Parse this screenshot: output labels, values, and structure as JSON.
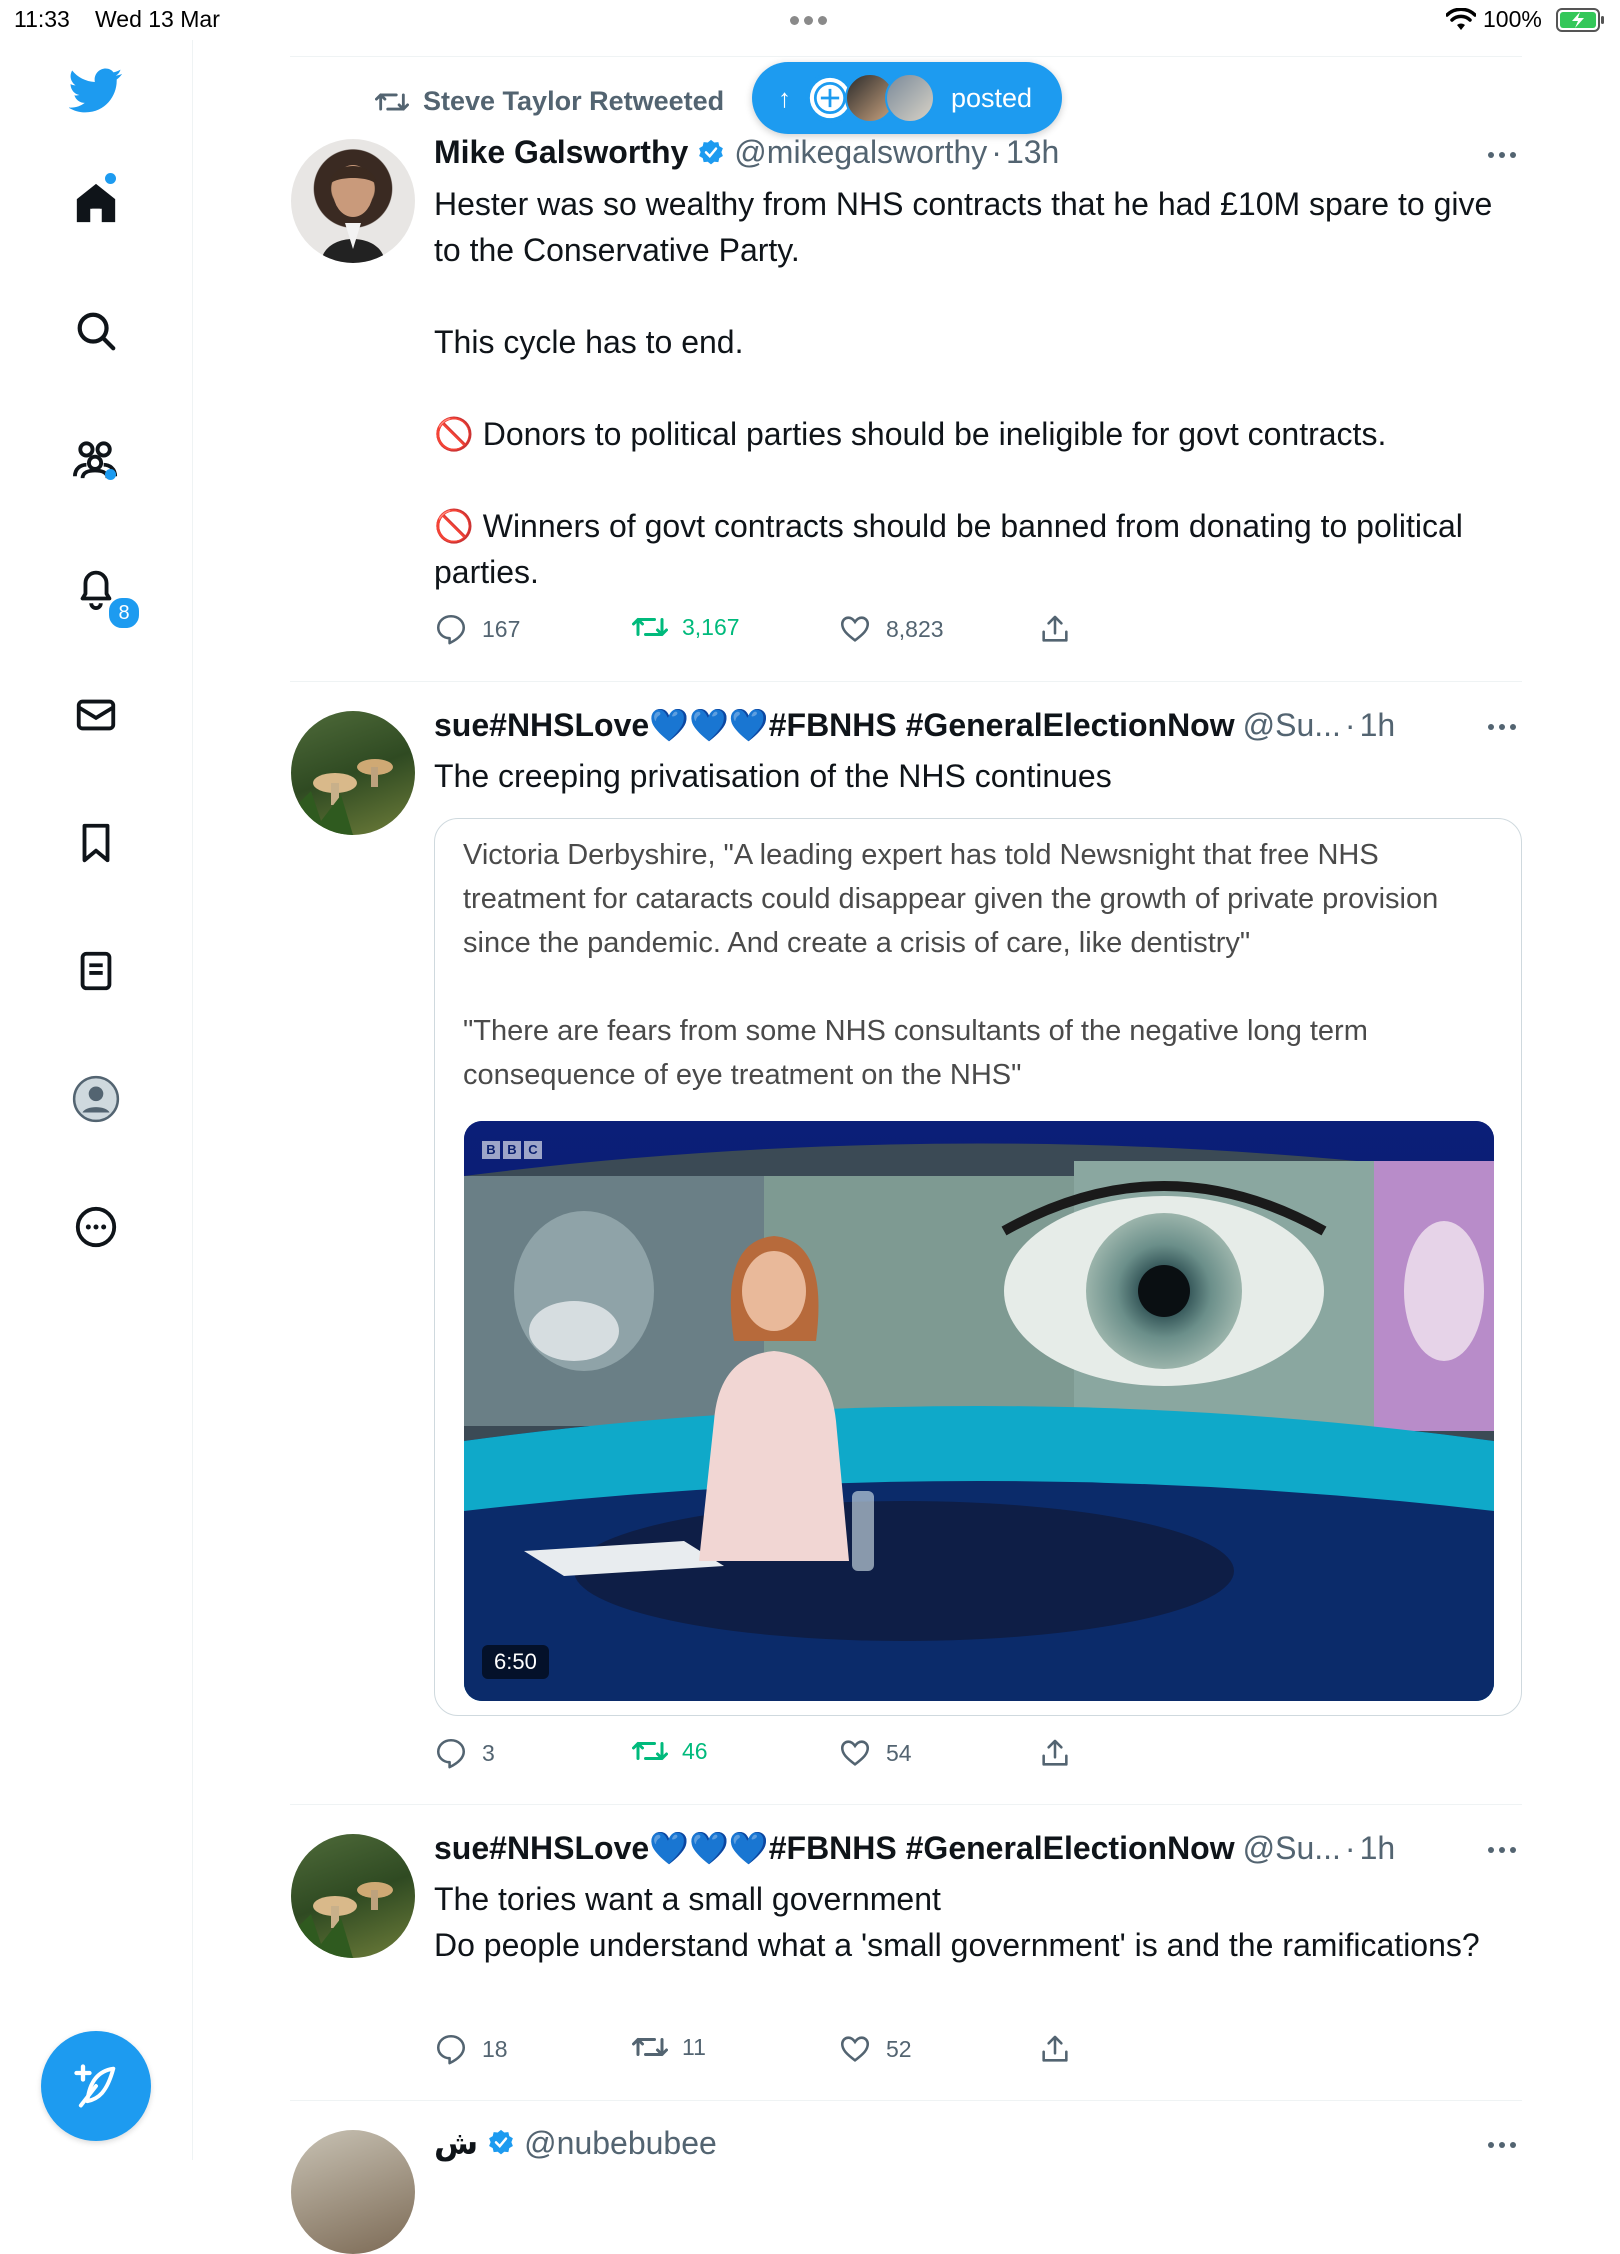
{
  "status_bar": {
    "time": "11:33",
    "date": "Wed 13 Mar",
    "battery": "100%"
  },
  "sidebar": {
    "items": [
      {
        "name": "home",
        "icon": "home-icon"
      },
      {
        "name": "search",
        "icon": "search-icon"
      },
      {
        "name": "communities",
        "icon": "communities-icon"
      },
      {
        "name": "notifications",
        "icon": "bell-icon",
        "badge": "8"
      },
      {
        "name": "messages",
        "icon": "envelope-icon"
      },
      {
        "name": "bookmarks",
        "icon": "bookmark-icon"
      },
      {
        "name": "lists",
        "icon": "list-icon"
      },
      {
        "name": "profile",
        "icon": "profile-icon"
      },
      {
        "name": "more",
        "icon": "more-circle-icon"
      }
    ],
    "compose_icon": "feather-plus-icon"
  },
  "new_posts_pill": {
    "arrow": "↑",
    "label": "posted"
  },
  "tweets": [
    {
      "retweeted_by": "Steve Taylor Retweeted",
      "name": "Mike Galsworthy",
      "handle": "@mikegalsworthy",
      "sep": "·",
      "time": "13h",
      "lines": [
        "Hester was so wealthy from NHS contracts that he had £10M spare to give to the Conservative Party.",
        "",
        "This cycle has to end.",
        "",
        "🚫 Donors to political parties should be ineligible for govt contracts.",
        "",
        "🚫 Winners of govt contracts should be banned from donating to political parties."
      ],
      "replies": "167",
      "retweets": "3,167",
      "likes": "8,823"
    },
    {
      "name": "sue#NHSLove💙💙💙#FBNHS #GeneralElectionNow",
      "handle": "@Su...",
      "sep": "·",
      "time": "1h",
      "lines": [
        "The creeping privatisation of the NHS continues"
      ],
      "quote": {
        "text1": "Victoria Derbyshire, \"A leading expert has told Newsnight that free NHS treatment for cataracts could disappear given the growth of private provision since the pandemic. And create a crisis of care, like dentistry\"",
        "text2": "\"There are fears from some NHS consultants of the negative long term consequence of eye treatment on the NHS\"",
        "video_duration": "6:50",
        "video_logo": [
          "B",
          "B",
          "C"
        ]
      },
      "replies": "3",
      "retweets": "46",
      "likes": "54"
    },
    {
      "name": "sue#NHSLove💙💙💙#FBNHS #GeneralElectionNow",
      "handle": "@Su...",
      "sep": "·",
      "time": "1h",
      "lines": [
        "The tories want a small government",
        "Do people understand what a 'small government' is and the ramifications?"
      ],
      "replies": "18",
      "retweets": "11",
      "likes": "52"
    },
    {
      "name": "ش",
      "handle": "@nubebubee"
    }
  ],
  "colors": {
    "accent": "#1d9bf0",
    "retweet": "#00ba7c",
    "muted": "#536471"
  }
}
